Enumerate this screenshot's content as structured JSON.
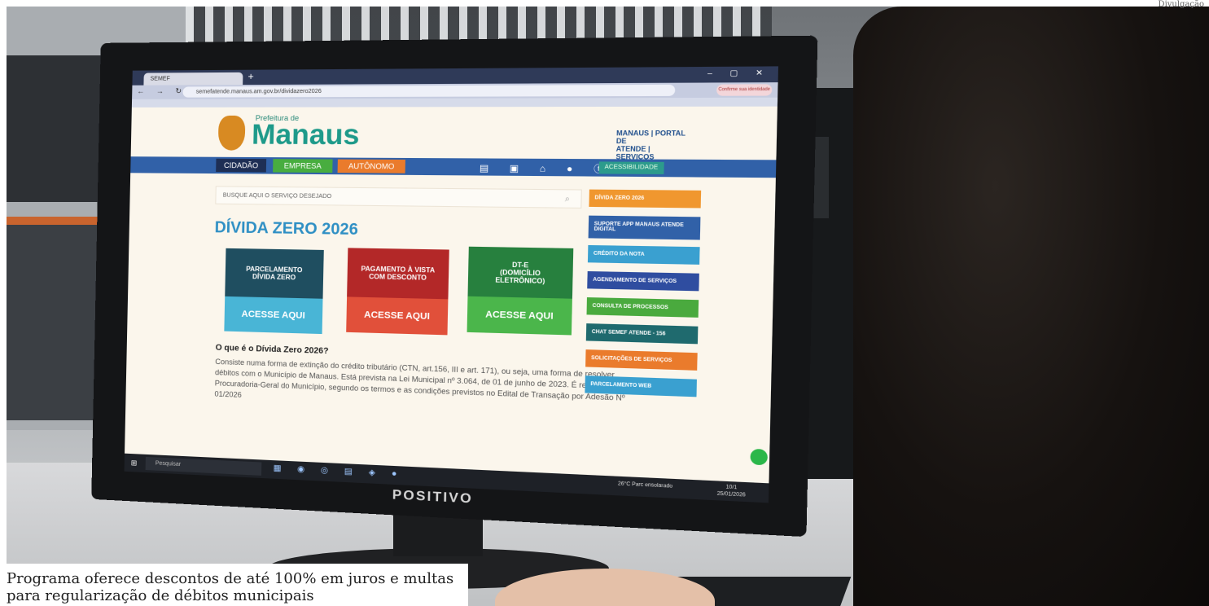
{
  "credit": "Divulgação",
  "caption": "Programa oferece descontos de até 100% em juros e multas para regularização de débitos municipais",
  "monitor": {
    "brand": "POSITIVO"
  },
  "browser": {
    "tab_title": "SEMEF",
    "url": "semefatende.manaus.am.gov.br/dividazero2026",
    "profile_label": "Confirme sua identidade"
  },
  "site": {
    "logo_small": "Prefeitura de",
    "logo_big": "Manaus",
    "portal_line1": "MANAUS | PORTAL DE",
    "portal_line2": "ATENDE | SERVIÇOS",
    "menu": {
      "cidadao": "CIDADÃO",
      "empresa": "EMPRESA",
      "autonomo": "AUTÔNOMO",
      "acessibilidade": "ACESSIBILIDADE"
    },
    "search_placeholder": "BUSQUE AQUI O SERVIÇO DESEJADO",
    "page_title": "DÍVIDA ZERO 2026",
    "cards": [
      {
        "title": "PARCELAMENTO\nDÍVIDA ZERO",
        "action": "ACESSE AQUI"
      },
      {
        "title": "PAGAMENTO À VISTA\nCOM DESCONTO",
        "action": "ACESSE AQUI"
      },
      {
        "title": "DT-E\n(DOMICÍLIO\nELETRÔNICO)",
        "action": "ACESSE AQUI"
      }
    ],
    "question_title": "O que é o Dívida Zero 2026?",
    "question_text": "Consiste numa forma de extinção do crédito tributário (CTN, art.156, III e art. 171), ou seja, uma forma de resolver débitos com o Município de Manaus. Está prevista na Lei Municipal nº 3.064, de 01 de junho de 2023. É realizado pela Procuradoria-Geral do Município, segundo os termos e as condições previstos no Edital de Transação por Adesão Nº 01/2026",
    "sidebar": [
      {
        "label": "DÍVIDA ZERO 2026",
        "color": "#f0972f"
      },
      {
        "label": "SUPORTE APP MANAUS ATENDE DIGITAL",
        "color": "#3161a8"
      },
      {
        "label": "CRÉDITO DA NOTA",
        "color": "#3aa0d0"
      },
      {
        "label": "AGENDAMENTO DE SERVIÇOS",
        "color": "#2f4da0"
      },
      {
        "label": "CONSULTA DE PROCESSOS",
        "color": "#4aaa3e"
      },
      {
        "label": "CHAT SEMEF ATENDE - 156",
        "color": "#1f6a6e"
      },
      {
        "label": "SOLICITAÇÕES DE SERVIÇOS",
        "color": "#ea7b2c"
      },
      {
        "label": "PARCELAMENTO WEB",
        "color": "#3aa0d0"
      }
    ]
  },
  "taskbar": {
    "search": "Pesquisar",
    "weather": "26°C  Parc ensolarado",
    "time": "10/1",
    "date": "25/01/2026"
  }
}
